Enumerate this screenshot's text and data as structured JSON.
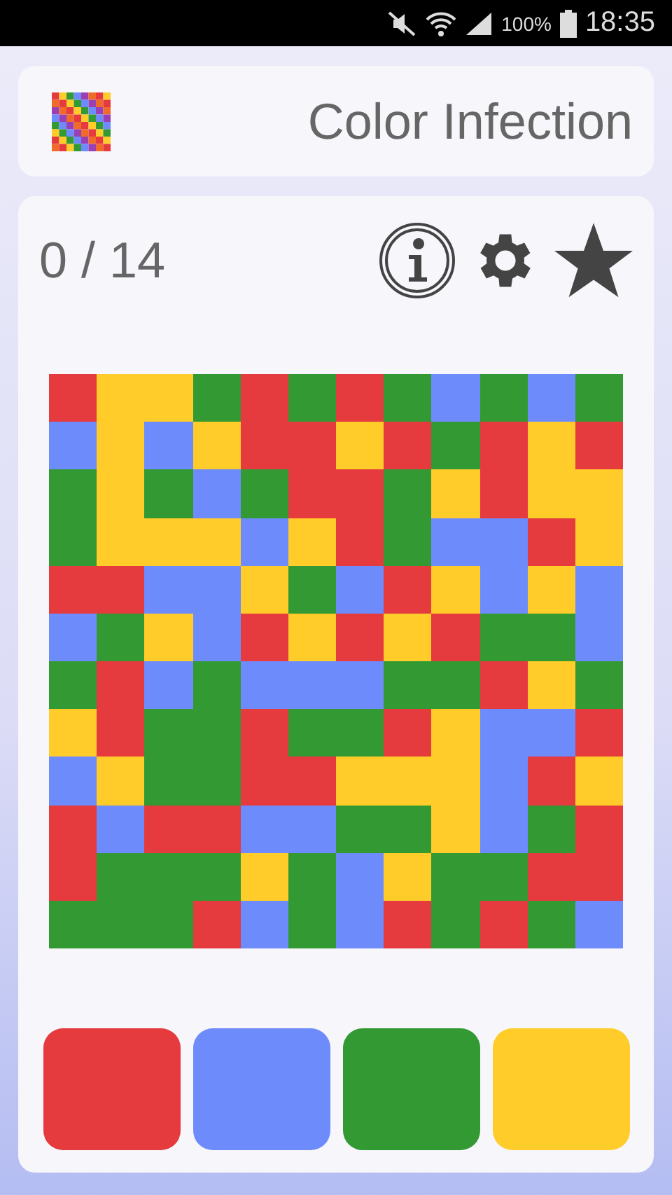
{
  "status_bar": {
    "battery_text": "100%",
    "time": "18:35"
  },
  "header": {
    "title": "Color Infection"
  },
  "game": {
    "score": "0 / 14",
    "board": [
      [
        {
          "color": "#e53a3e"
        },
        {
          "color": "#ffcc2a"
        },
        {
          "color": "#ffcc2a"
        },
        {
          "color": "#339933"
        },
        {
          "color": "#e53a3e"
        },
        {
          "color": "#339933"
        },
        {
          "color": "#e53a3e"
        },
        {
          "color": "#339933"
        },
        {
          "color": "#6e8bfc"
        },
        {
          "color": "#339933"
        },
        {
          "color": "#6e8bfc"
        },
        {
          "color": "#339933"
        }
      ],
      [
        {
          "color": "#6e8bfc"
        },
        {
          "color": "#ffcc2a"
        },
        {
          "color": "#6e8bfc"
        },
        {
          "color": "#ffcc2a"
        },
        {
          "color": "#e53a3e"
        },
        {
          "color": "#e53a3e"
        },
        {
          "color": "#ffcc2a"
        },
        {
          "color": "#e53a3e"
        },
        {
          "color": "#339933"
        },
        {
          "color": "#e53a3e"
        },
        {
          "color": "#ffcc2a"
        },
        {
          "color": "#e53a3e"
        }
      ],
      [
        {
          "color": "#339933"
        },
        {
          "color": "#ffcc2a"
        },
        {
          "color": "#339933"
        },
        {
          "color": "#6e8bfc"
        },
        {
          "color": "#339933"
        },
        {
          "color": "#e53a3e"
        },
        {
          "color": "#e53a3e"
        },
        {
          "color": "#339933"
        },
        {
          "color": "#ffcc2a"
        },
        {
          "color": "#e53a3e"
        },
        {
          "color": "#ffcc2a"
        },
        {
          "color": "#ffcc2a"
        }
      ],
      [
        {
          "color": "#339933"
        },
        {
          "color": "#ffcc2a"
        },
        {
          "color": "#ffcc2a"
        },
        {
          "color": "#ffcc2a"
        },
        {
          "color": "#6e8bfc"
        },
        {
          "color": "#ffcc2a"
        },
        {
          "color": "#e53a3e"
        },
        {
          "color": "#339933"
        },
        {
          "color": "#6e8bfc"
        },
        {
          "color": "#6e8bfc"
        },
        {
          "color": "#e53a3e"
        },
        {
          "color": "#ffcc2a"
        }
      ],
      [
        {
          "color": "#e53a3e"
        },
        {
          "color": "#e53a3e"
        },
        {
          "color": "#6e8bfc"
        },
        {
          "color": "#6e8bfc"
        },
        {
          "color": "#ffcc2a"
        },
        {
          "color": "#339933"
        },
        {
          "color": "#6e8bfc"
        },
        {
          "color": "#e53a3e"
        },
        {
          "color": "#ffcc2a"
        },
        {
          "color": "#6e8bfc"
        },
        {
          "color": "#ffcc2a"
        },
        {
          "color": "#6e8bfc"
        }
      ],
      [
        {
          "color": "#6e8bfc"
        },
        {
          "color": "#339933"
        },
        {
          "color": "#ffcc2a"
        },
        {
          "color": "#6e8bfc"
        },
        {
          "color": "#e53a3e"
        },
        {
          "color": "#ffcc2a"
        },
        {
          "color": "#e53a3e"
        },
        {
          "color": "#ffcc2a"
        },
        {
          "color": "#e53a3e"
        },
        {
          "color": "#339933"
        },
        {
          "color": "#339933"
        },
        {
          "color": "#6e8bfc"
        }
      ],
      [
        {
          "color": "#339933"
        },
        {
          "color": "#e53a3e"
        },
        {
          "color": "#6e8bfc"
        },
        {
          "color": "#339933"
        },
        {
          "color": "#6e8bfc"
        },
        {
          "color": "#6e8bfc"
        },
        {
          "color": "#6e8bfc"
        },
        {
          "color": "#339933"
        },
        {
          "color": "#339933"
        },
        {
          "color": "#e53a3e"
        },
        {
          "color": "#ffcc2a"
        },
        {
          "color": "#339933"
        }
      ],
      [
        {
          "color": "#ffcc2a"
        },
        {
          "color": "#e53a3e"
        },
        {
          "color": "#339933"
        },
        {
          "color": "#339933"
        },
        {
          "color": "#e53a3e"
        },
        {
          "color": "#339933"
        },
        {
          "color": "#339933"
        },
        {
          "color": "#e53a3e"
        },
        {
          "color": "#ffcc2a"
        },
        {
          "color": "#6e8bfc"
        },
        {
          "color": "#6e8bfc"
        },
        {
          "color": "#e53a3e"
        }
      ],
      [
        {
          "color": "#6e8bfc"
        },
        {
          "color": "#ffcc2a"
        },
        {
          "color": "#339933"
        },
        {
          "color": "#339933"
        },
        {
          "color": "#e53a3e"
        },
        {
          "color": "#e53a3e"
        },
        {
          "color": "#ffcc2a"
        },
        {
          "color": "#ffcc2a"
        },
        {
          "color": "#ffcc2a"
        },
        {
          "color": "#6e8bfc"
        },
        {
          "color": "#e53a3e"
        },
        {
          "color": "#ffcc2a"
        }
      ],
      [
        {
          "color": "#e53a3e"
        },
        {
          "color": "#6e8bfc"
        },
        {
          "color": "#e53a3e"
        },
        {
          "color": "#e53a3e"
        },
        {
          "color": "#6e8bfc"
        },
        {
          "color": "#6e8bfc"
        },
        {
          "color": "#339933"
        },
        {
          "color": "#339933"
        },
        {
          "color": "#ffcc2a"
        },
        {
          "color": "#6e8bfc"
        },
        {
          "color": "#339933"
        },
        {
          "color": "#e53a3e"
        }
      ],
      [
        {
          "color": "#e53a3e"
        },
        {
          "color": "#339933"
        },
        {
          "color": "#339933"
        },
        {
          "color": "#339933"
        },
        {
          "color": "#ffcc2a"
        },
        {
          "color": "#339933"
        },
        {
          "color": "#6e8bfc"
        },
        {
          "color": "#ffcc2a"
        },
        {
          "color": "#339933"
        },
        {
          "color": "#339933"
        },
        {
          "color": "#e53a3e"
        },
        {
          "color": "#e53a3e"
        }
      ],
      [
        {
          "color": "#339933"
        },
        {
          "color": "#339933"
        },
        {
          "color": "#339933"
        },
        {
          "color": "#e53a3e"
        },
        {
          "color": "#6e8bfc"
        },
        {
          "color": "#339933"
        },
        {
          "color": "#6e8bfc"
        },
        {
          "color": "#e53a3e"
        },
        {
          "color": "#339933"
        },
        {
          "color": "#e53a3e"
        },
        {
          "color": "#339933"
        },
        {
          "color": "#6e8bfc"
        }
      ]
    ],
    "color_buttons": [
      {
        "color": "#e53a3e"
      },
      {
        "color": "#6e8bfc"
      },
      {
        "color": "#339933"
      },
      {
        "color": "#ffcc2a"
      }
    ]
  }
}
